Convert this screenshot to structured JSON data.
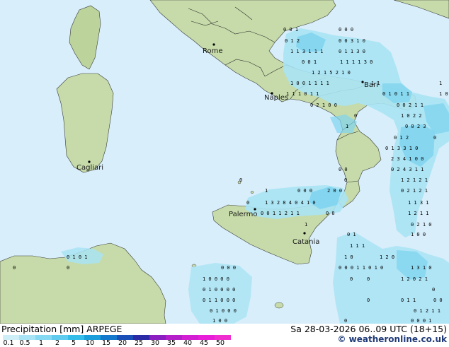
{
  "map": {
    "cities": {
      "rome": "Rome",
      "naples": "Naples",
      "bari": "Bari",
      "cagliari": "Cagliari",
      "palermo": "Palermo",
      "catania": "Catania"
    }
  },
  "legend": {
    "title": "Precipitation [mm]  ARPEGE",
    "datetime": "Sa 28-03-2026 06..09 UTC (18+15)",
    "credit": "© weatheronline.co.uk",
    "scale": [
      "0.1",
      "0.5",
      "1",
      "2",
      "5",
      "10",
      "15",
      "20",
      "25",
      "30",
      "35",
      "40",
      "45",
      "50"
    ],
    "colors": [
      "#cfeff8",
      "#a8e4f5",
      "#86d9f2",
      "#5fcbee",
      "#35bde9",
      "#1a9fdc",
      "#1478cc",
      "#1b4fb8",
      "#2a2aa6",
      "#8a1ec0",
      "#b41fc9",
      "#d21fd3",
      "#e81ed8",
      "#f02ecf"
    ]
  },
  "colors": {
    "sea": "#d8eefa",
    "land": "#c9ddb0",
    "rain_light": "#a9e3f4",
    "rain_mid": "#7fd4ef"
  }
}
